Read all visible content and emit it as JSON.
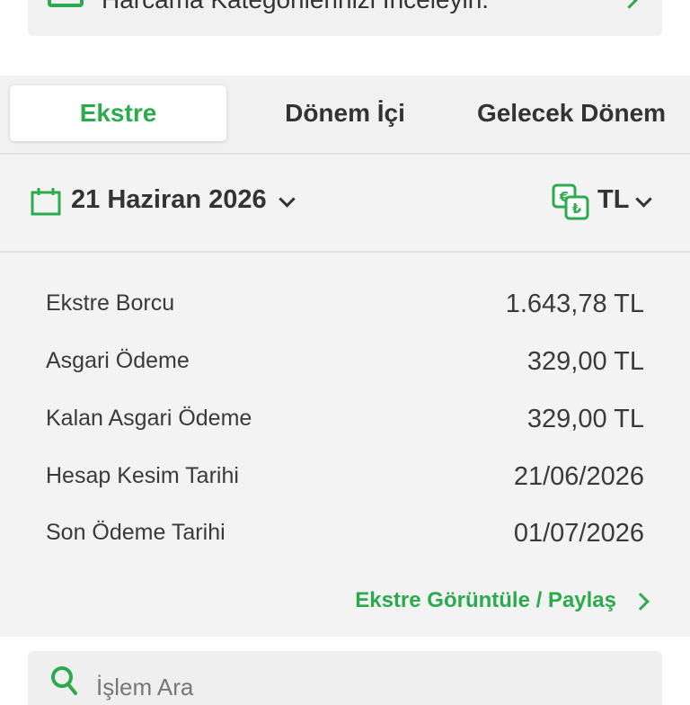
{
  "banner": {
    "text": "Harcama Kategorilerinizi İnceleyin.",
    "icon": "card-icon",
    "chevron": "chevron-right-icon"
  },
  "tabs": [
    {
      "label": "Ekstre",
      "active": true
    },
    {
      "label": "Dönem İçi",
      "active": false
    },
    {
      "label": "Gelecek Dönem",
      "active": false
    }
  ],
  "filter": {
    "date": "21 Haziran 2026",
    "currency": "TL"
  },
  "summary": {
    "rows": [
      {
        "label": "Ekstre Borcu",
        "value": "1.643,78 TL"
      },
      {
        "label": "Asgari Ödeme",
        "value": "329,00 TL"
      },
      {
        "label": "Kalan Asgari Ödeme",
        "value": "329,00 TL"
      },
      {
        "label": "Hesap Kesim Tarihi",
        "value": "21/06/2026"
      },
      {
        "label": "Son Ödeme Tarihi",
        "value": "01/07/2026"
      }
    ],
    "link": "Ekstre Görüntüle / Paylaş"
  },
  "search": {
    "placeholder": "İşlem Ara"
  },
  "colors": {
    "accent": "#2bab4e",
    "text": "#333333",
    "panel": "#f3f3f3"
  }
}
